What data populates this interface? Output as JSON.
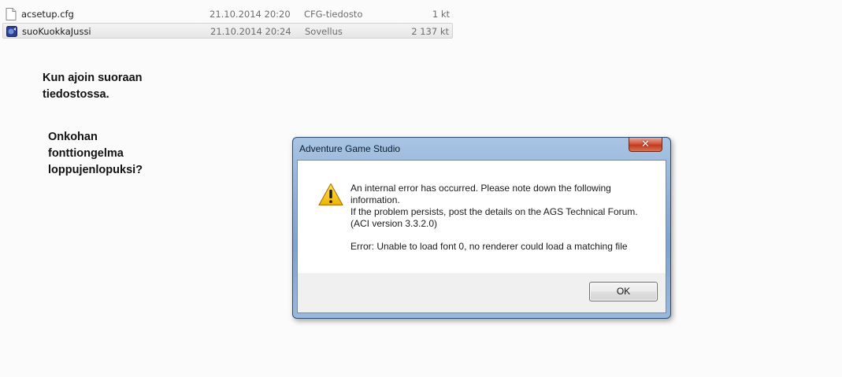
{
  "files": [
    {
      "name": "acsetup.cfg",
      "date": "21.10.2014 20:20",
      "type": "CFG-tiedosto",
      "size": "1 kt",
      "icon": "document-file-icon",
      "selected": false
    },
    {
      "name": "suoKuokkaJussi",
      "date": "21.10.2014 20:24",
      "type": "Sovellus",
      "size": "2 137 kt",
      "icon": "ags-application-icon",
      "selected": true
    }
  ],
  "notes": {
    "first": [
      "Kun ajoin suoraan",
      "tiedostossa."
    ],
    "second": [
      "Onkohan",
      "fonttiongelma",
      "loppujenlopuksi?"
    ]
  },
  "dialog": {
    "title": "Adventure Game Studio",
    "close_symbol": "✕",
    "icon": "warning-icon",
    "message_lines": [
      "An internal error has occurred. Please note down the following",
      "information.",
      "If the problem persists, post the details on the AGS Technical Forum.",
      "(ACI version 3.3.2.0)"
    ],
    "error_line": "Error: Unable to load font 0, no renderer could load a matching file",
    "ok_label": "OK"
  },
  "colors": {
    "accent_title_bar": "#8fb0d6",
    "close_button": "#c33a20",
    "warning_yellow": "#f2c200"
  }
}
